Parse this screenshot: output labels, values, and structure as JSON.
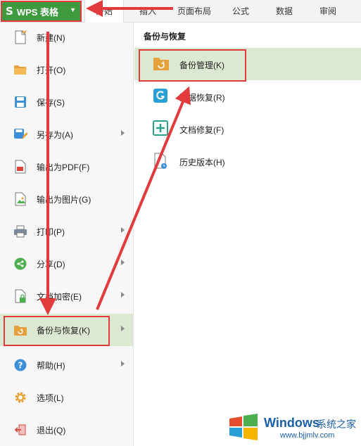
{
  "app_button": {
    "label": "WPS 表格",
    "logo": "S"
  },
  "ribbon_tabs": [
    "开始",
    "插入",
    "页面布局",
    "公式",
    "数据",
    "审阅"
  ],
  "left_menu": [
    {
      "label": "新建(N)",
      "icon": "new-file-icon",
      "has_submenu": false
    },
    {
      "label": "打开(O)",
      "icon": "open-folder-icon",
      "has_submenu": false
    },
    {
      "label": "保存(S)",
      "icon": "save-icon",
      "has_submenu": false
    },
    {
      "label": "另存为(A)",
      "icon": "save-as-icon",
      "has_submenu": true
    },
    {
      "label": "输出为PDF(F)",
      "icon": "pdf-export-icon",
      "has_submenu": false
    },
    {
      "label": "输出为图片(G)",
      "icon": "image-export-icon",
      "has_submenu": false
    },
    {
      "label": "打印(P)",
      "icon": "print-icon",
      "has_submenu": true
    },
    {
      "label": "分享(D)",
      "icon": "share-icon",
      "has_submenu": true
    },
    {
      "label": "文档加密(E)",
      "icon": "encrypt-icon",
      "has_submenu": true
    },
    {
      "label": "备份与恢复(K)",
      "icon": "backup-restore-icon",
      "has_submenu": true,
      "active": true
    },
    {
      "label": "帮助(H)",
      "icon": "help-icon",
      "has_submenu": true
    },
    {
      "label": "选项(L)",
      "icon": "settings-gear-icon",
      "has_submenu": false
    },
    {
      "label": "退出(Q)",
      "icon": "exit-icon",
      "has_submenu": false
    }
  ],
  "right_panel": {
    "title": "备份与恢复",
    "items": [
      {
        "label": "备份管理(K)",
        "icon": "backup-folder-icon",
        "active": true
      },
      {
        "label": "数据恢复(R)",
        "icon": "data-recovery-icon"
      },
      {
        "label": "文档修复(F)",
        "icon": "document-repair-icon"
      },
      {
        "label": "历史版本(H)",
        "icon": "history-version-icon"
      }
    ]
  },
  "watermark": {
    "brand": "Windows",
    "cn": "系统之家",
    "url": "www.bjjmlv.com"
  },
  "colors": {
    "accent_green": "#3f9a3f",
    "highlight": "#dde8d2",
    "annotation_red": "#e23b3b"
  }
}
